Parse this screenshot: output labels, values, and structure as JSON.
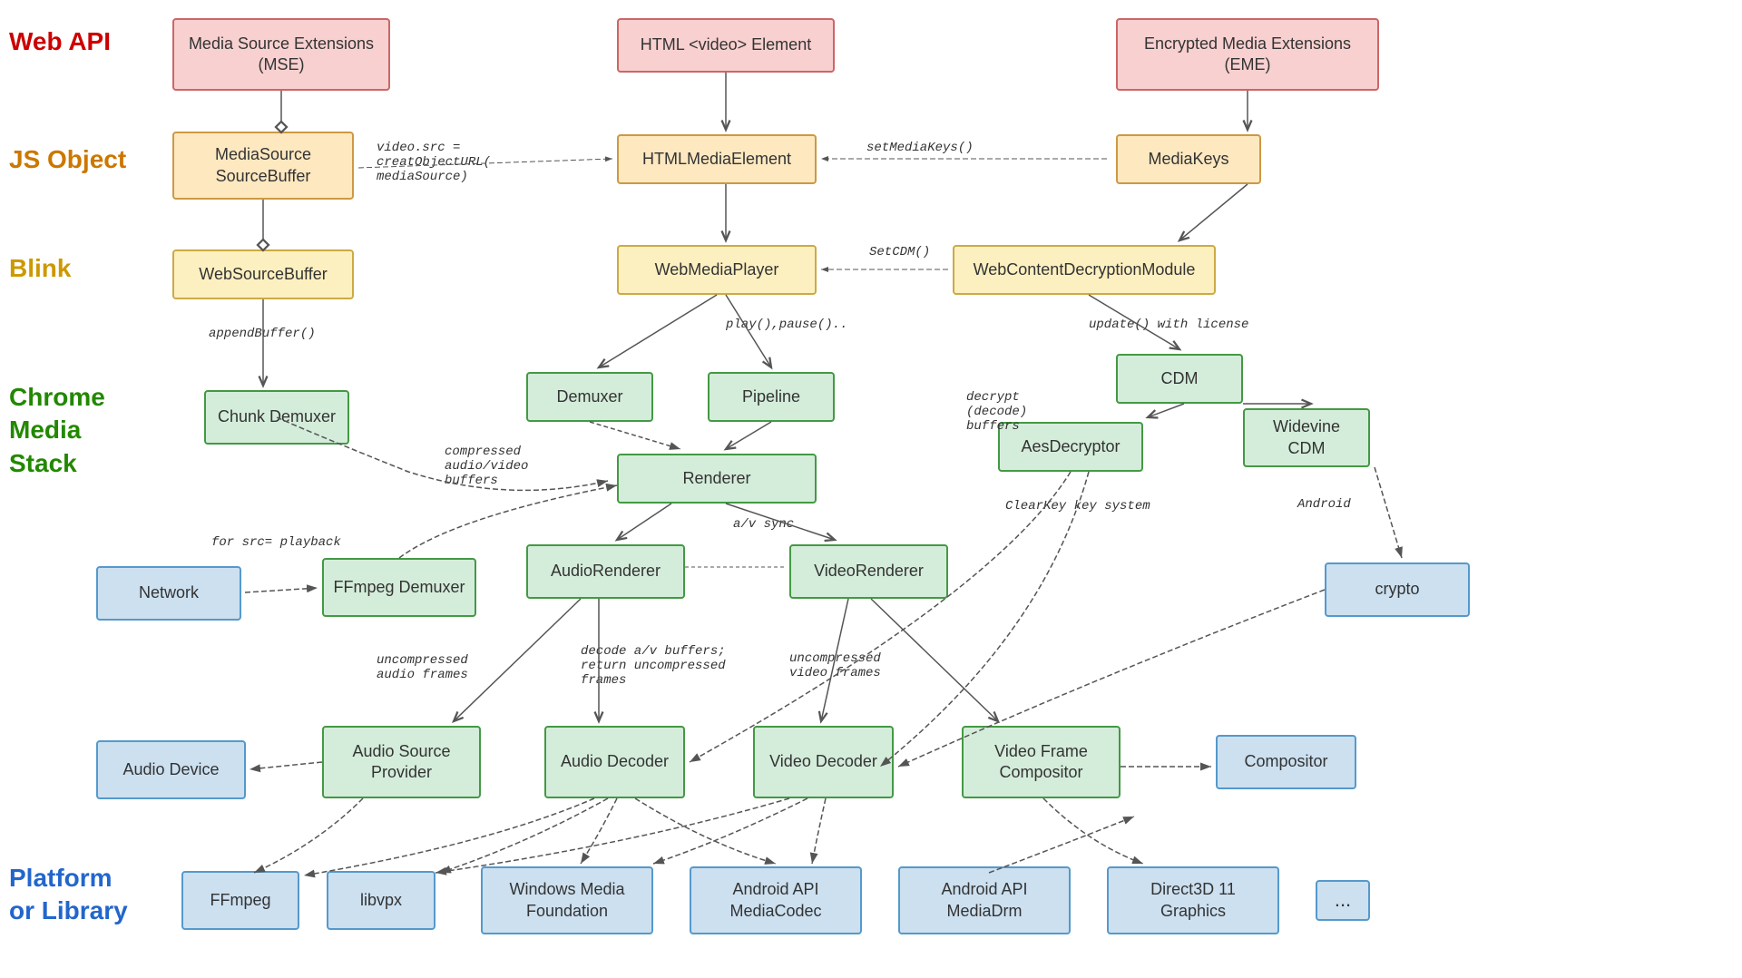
{
  "labels": {
    "webapi": "Web API",
    "jsobject": "JS Object",
    "blink": "Blink",
    "chromemedia": "Chrome\nMedia\nStack",
    "platform": "Platform\nor Library"
  },
  "boxes": {
    "mse": "Media Source Extensions\n(MSE)",
    "html_video": "HTML <video> Element",
    "eme": "Encrypted Media Extensions\n(EME)",
    "mediasource_sourcebuffer": "MediaSource\nSourceBuffer",
    "htmlmediaelement": "HTMLMediaElement",
    "mediakeys": "MediaKeys",
    "websourcebuffer": "WebSourceBuffer",
    "webmediaplayer": "WebMediaPlayer",
    "webcontentdecryptionmodule": "WebContentDecryptionModule",
    "chunk_demuxer": "Chunk\nDemuxer",
    "demuxer": "Demuxer",
    "pipeline": "Pipeline",
    "cdm": "CDM",
    "renderer": "Renderer",
    "aesdecryptor": "AesDecryptor",
    "widevinecdm": "Widevine\nCDM",
    "network": "Network",
    "ffmpeg_demuxer": "FFmpeg\nDemuxer",
    "audiorenderer": "AudioRenderer",
    "videorenderer": "VideoRenderer",
    "crypto": "crypto",
    "audio_device": "Audio Device",
    "audio_source_provider": "Audio Source\nProvider",
    "audio_decoder": "Audio\nDecoder",
    "video_decoder": "Video\nDecoder",
    "video_frame_compositor": "Video Frame\nCompositor",
    "compositor": "Compositor",
    "ffmpeg": "FFmpeg",
    "libvpx": "libvpx",
    "windows_media_foundation": "Windows Media\nFoundation",
    "android_api_mediacodec": "Android API\nMediaCodec",
    "android_api_mediadrm": "Android API\nMediaDrm",
    "direct3d": "Direct3D 11\nGraphics",
    "ellipsis": "..."
  },
  "annotations": {
    "video_src": "video.src =\ncreatObjectURL(\nmediaSource)",
    "appendbuffer": "appendBuffer()",
    "setmediakeys": "setMediaKeys()",
    "setcdm": "SetCDM()",
    "playpause": "play(),pause()..",
    "update_license": "update() with license",
    "decrypt_buffers": "decrypt\n(decode)\nbuffers",
    "compressed_buffers": "compressed\naudio/video\nbuffers",
    "for_src_playback": "for src= playback",
    "uncompressed_audio": "uncompressed\naudio frames",
    "decode_buffers": "decode a/v buffers;\nreturn uncompressed\nframes",
    "uncompressed_video": "uncompressed\nvideo frames",
    "av_sync": "a/v\nsync",
    "clearkey": "ClearKey\nkey system",
    "android": "Android"
  }
}
